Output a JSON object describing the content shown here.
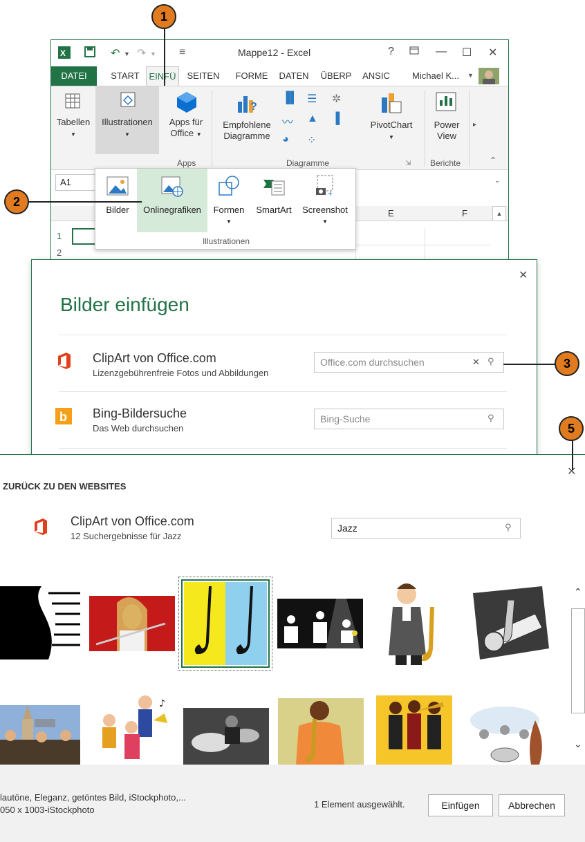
{
  "excel": {
    "title": "Mappe12 - Excel",
    "help": "?",
    "tabs": [
      "DATEI",
      "START",
      "EINFÜ",
      "SEITEN",
      "FORME",
      "DATEN",
      "ÜBERP",
      "ANSIC"
    ],
    "user": "Michael K...",
    "ribbon": {
      "tabellen": "Tabellen",
      "illustrationen": "Illustrationen",
      "apps_line1": "Apps für",
      "apps_line2": "Office",
      "empf_line1": "Empfohlene",
      "empf_line2": "Diagramme",
      "pivotchart": "PivotChart",
      "power_line1": "Power",
      "power_line2": "View",
      "group_apps": "Apps",
      "group_diagramme": "Diagramme",
      "group_berichte": "Berichte"
    },
    "namebox": "A1",
    "columns": [
      "E",
      "F"
    ],
    "rows": [
      "1",
      "2"
    ]
  },
  "illustrations_popup": {
    "items": [
      "Bilder",
      "Onlinegrafiken",
      "Formen",
      "SmartArt",
      "Screenshot"
    ],
    "group_label": "Illustrationen"
  },
  "insert_dialog": {
    "title": "Bilder einfügen",
    "clipart_title": "ClipArt von Office.com",
    "clipart_sub": "Lizenzgebührenfreie Fotos und Abbildungen",
    "clipart_placeholder": "Office.com durchsuchen",
    "bing_title": "Bing-Bildersuche",
    "bing_sub": "Das Web durchsuchen",
    "bing_placeholder": "Bing-Suche"
  },
  "results": {
    "back": "ZURÜCK ZU DEN WEBSITES",
    "title": "ClipArt von Office.com",
    "subtitle": "12 Suchergebnisse für Jazz",
    "search_value": "Jazz",
    "footer_line1": "lautöne, Eleganz, getöntes Bild, iStockphoto,...",
    "footer_line2": "050 x 1003-iStockphoto",
    "selected_count": "1 Element ausgewählt.",
    "insert": "Einfügen",
    "cancel": "Abbrechen"
  },
  "callouts": [
    "1",
    "2",
    "3",
    "5"
  ],
  "colors": {
    "excel_green": "#217346",
    "office_red": "#e2401c",
    "bing_orange": "#f5a018",
    "callout": "#e07b1f"
  }
}
